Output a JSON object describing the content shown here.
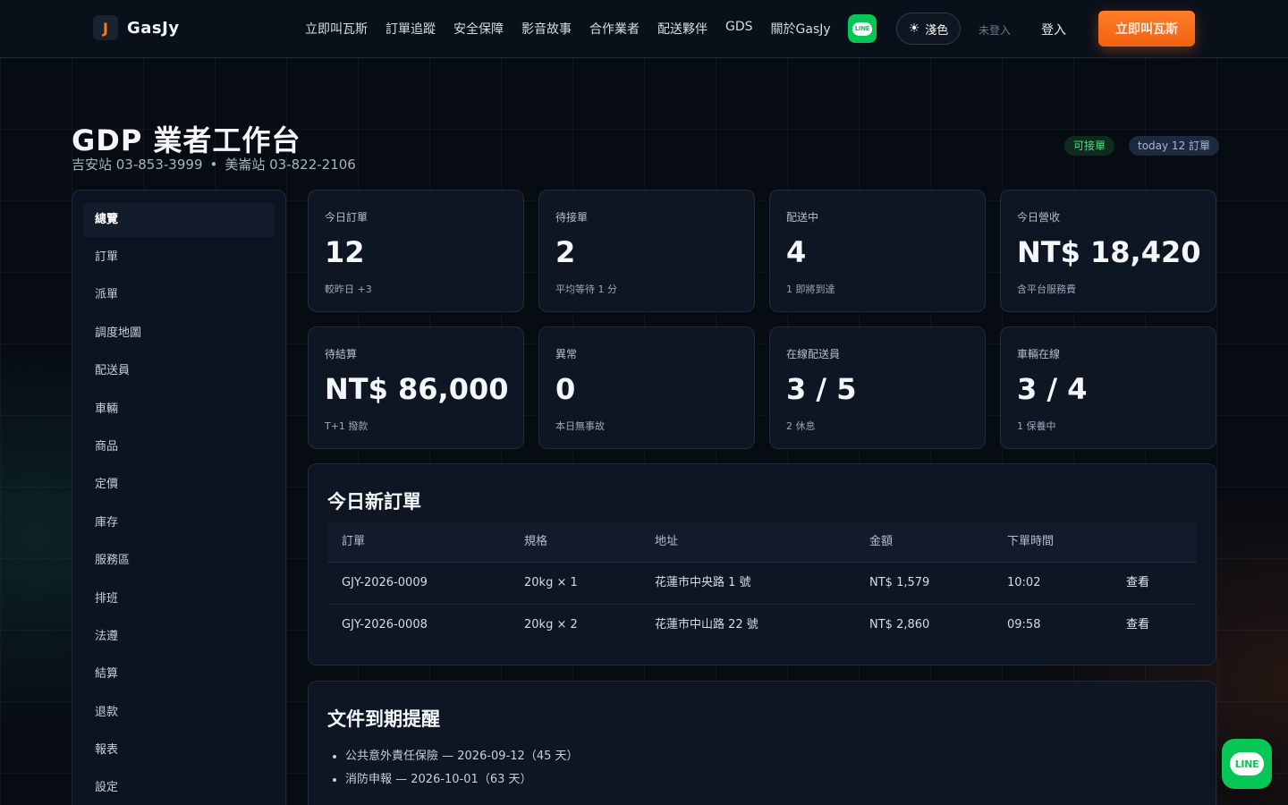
{
  "nav": {
    "brand_mark": "J",
    "brand": "GasJy",
    "links": [
      "立即叫瓦斯",
      "訂單追蹤",
      "安全保障",
      "影音故事",
      "合作業者",
      "配送夥伴",
      "GDS",
      "關於GasJy"
    ],
    "line_label": "LINE",
    "theme_label": "淺色",
    "login_status": "未登入",
    "login": "登入",
    "cta": "立即叫瓦斯"
  },
  "header": {
    "title": "GDP 業者工作台",
    "station1": "吉安站 03-853-3999",
    "separator": "•",
    "station2": "美崙站 03-822-2106",
    "badge_status": "可接單",
    "badge_today": "today 12 訂單"
  },
  "sidebar": {
    "items": [
      "總覽",
      "訂單",
      "派單",
      "調度地圖",
      "配送員",
      "車輛",
      "商品",
      "定價",
      "庫存",
      "服務區",
      "排班",
      "法遵",
      "結算",
      "退款",
      "報表",
      "設定"
    ],
    "active_index": 0
  },
  "stats": [
    {
      "label": "今日訂單",
      "value": "12",
      "note": "較昨日 +3"
    },
    {
      "label": "待接單",
      "value": "2",
      "note": "平均等待 1 分"
    },
    {
      "label": "配送中",
      "value": "4",
      "note": "1 即將到達"
    },
    {
      "label": "今日營收",
      "value": "NT$ 18,420",
      "note": "含平台服務費"
    },
    {
      "label": "待結算",
      "value": "NT$ 86,000",
      "note": "T+1 撥款"
    },
    {
      "label": "異常",
      "value": "0",
      "note": "本日無事故"
    },
    {
      "label": "在線配送員",
      "value": "3 / 5",
      "note": "2 休息"
    },
    {
      "label": "車輛在線",
      "value": "3 / 4",
      "note": "1 保養中"
    }
  ],
  "orders": {
    "title": "今日新訂單",
    "columns": [
      "訂單",
      "規格",
      "地址",
      "金額",
      "下單時間"
    ],
    "rows": [
      {
        "id": "GJY-2026-0009",
        "spec": "20kg × 1",
        "address": "花蓮市中央路 1 號",
        "amount": "NT$ 1,579",
        "time": "10:02",
        "action": "查看"
      },
      {
        "id": "GJY-2026-0008",
        "spec": "20kg × 2",
        "address": "花蓮市中山路 22 號",
        "amount": "NT$ 2,860",
        "time": "09:58",
        "action": "查看"
      }
    ]
  },
  "documents": {
    "title": "文件到期提醒",
    "items": [
      "公共意外責任保險 — 2026-09-12（45 天）",
      "消防申報 — 2026-10-01（63 天）"
    ]
  },
  "float_line_label": "LINE"
}
